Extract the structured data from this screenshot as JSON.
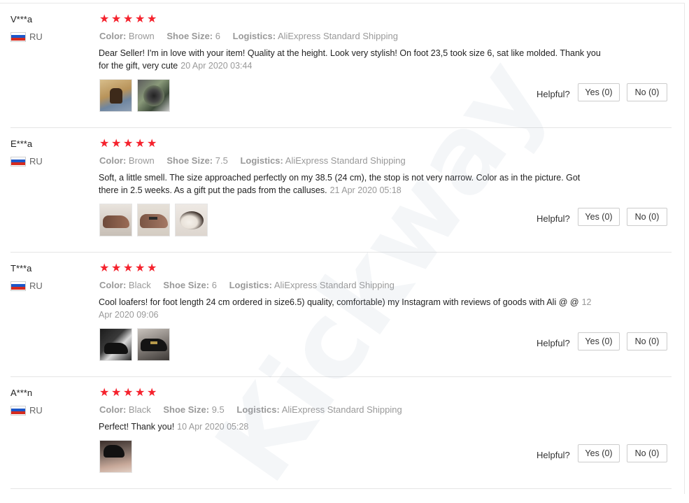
{
  "colors": {
    "star": "#f5222d",
    "meta_gray": "#999999",
    "separator": "#e5e5e5"
  },
  "icons": {
    "star": "star-icon",
    "flag": "russia-flag-icon"
  },
  "watermark": "Kickway",
  "reviews": [
    {
      "user": "V***a",
      "country": "RU",
      "rating": 5,
      "color_label": "Color:",
      "color": "Brown",
      "size_label": "Shoe Size:",
      "size": "6",
      "logistics_label": "Logistics:",
      "logistics": "AliExpress Standard Shipping",
      "text": "Dear Seller! I'm in love with your item! Quality at the height. Look very stylish! On foot 23,5 took size 6, sat like molded. Thank you for the gift, very cute",
      "date": "20 Apr 2020 03:44",
      "helpful_label": "Helpful?",
      "yes_label": "Yes (0)",
      "no_label": "No (0)"
    },
    {
      "user": "E***a",
      "country": "RU",
      "rating": 5,
      "color_label": "Color:",
      "color": "Brown",
      "size_label": "Shoe Size:",
      "size": "7.5",
      "logistics_label": "Logistics:",
      "logistics": "AliExpress Standard Shipping",
      "text": "Soft, a little smell. The size approached perfectly on my 38.5 (24 cm), the stop is not very narrow. Color as in the picture. Got there in 2.5 weeks. As a gift put the pads from the calluses.",
      "date": "21 Apr 2020 05:18",
      "helpful_label": "Helpful?",
      "yes_label": "Yes (0)",
      "no_label": "No (0)"
    },
    {
      "user": "T***a",
      "country": "RU",
      "rating": 5,
      "color_label": "Color:",
      "color": "Black",
      "size_label": "Shoe Size:",
      "size": "6",
      "logistics_label": "Logistics:",
      "logistics": "AliExpress Standard Shipping",
      "text": "Cool loafers! for foot length 24 cm ordered in size6.5) quality, comfortable) my Instagram with reviews of goods with Ali @ @",
      "date": "12 Apr 2020 09:06",
      "helpful_label": "Helpful?",
      "yes_label": "Yes (0)",
      "no_label": "No (0)"
    },
    {
      "user": "A***n",
      "country": "RU",
      "rating": 5,
      "color_label": "Color:",
      "color": "Black",
      "size_label": "Shoe Size:",
      "size": "9.5",
      "logistics_label": "Logistics:",
      "logistics": "AliExpress Standard Shipping",
      "text": "Perfect! Thank you!",
      "date": "10 Apr 2020 05:28",
      "helpful_label": "Helpful?",
      "yes_label": "Yes (0)",
      "no_label": "No (0)"
    }
  ]
}
